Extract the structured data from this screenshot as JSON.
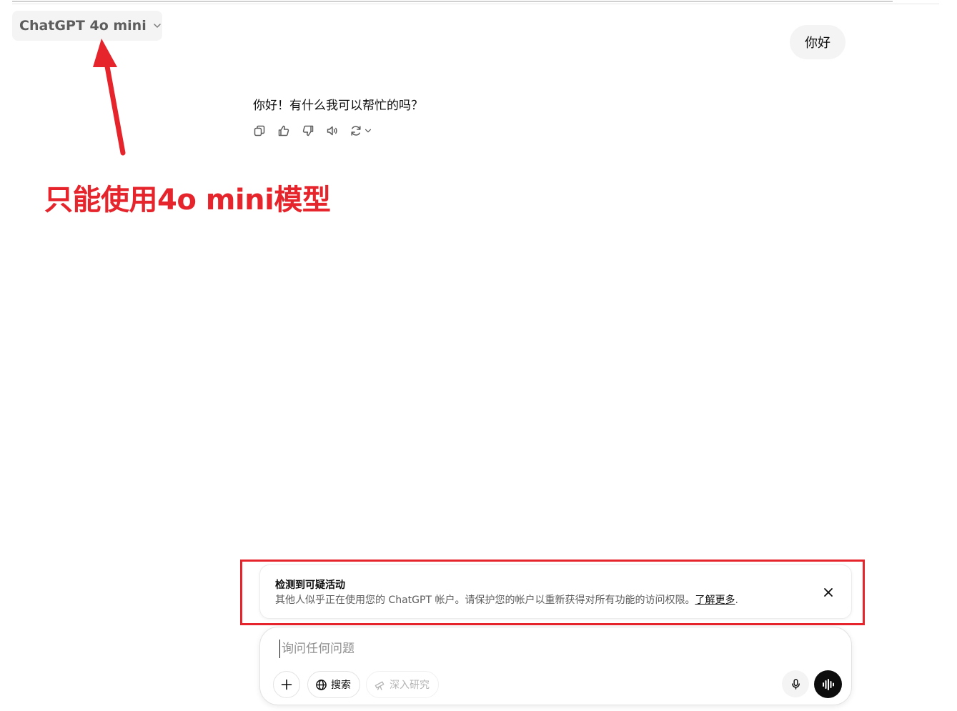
{
  "header": {
    "model_name": "ChatGPT 4o mini"
  },
  "conversation": {
    "user_message": "你好",
    "assistant_message": "你好！有什么我可以帮忙的吗？"
  },
  "annotation": {
    "text": "只能使用4o mini模型",
    "color": "#e5242b"
  },
  "alert": {
    "title": "检测到可疑活动",
    "body": "其他人似乎正在使用您的 ChatGPT 帐户。请保护您的帐户以重新获得对所有功能的访问权限。",
    "link_label": "了解更多",
    "trailing": "."
  },
  "composer": {
    "placeholder": "询问任何问题",
    "search_label": "搜索",
    "deep_research_label": "深入研究"
  },
  "icons": {
    "model_dropdown": "chevron-down-icon",
    "actions": [
      "copy-icon",
      "thumbs-up-icon",
      "thumbs-down-icon",
      "read-aloud-icon",
      "regenerate-icon"
    ],
    "composer": [
      "plus-icon",
      "globe-icon",
      "telescope-icon",
      "microphone-icon",
      "voice-mode-icon"
    ],
    "alert_close": "close-icon"
  },
  "colors": {
    "accent_annotation": "#e5242b",
    "bubble_bg": "#f4f4f4",
    "text_primary": "#0d0d0d",
    "text_secondary": "#5d5d5d"
  }
}
